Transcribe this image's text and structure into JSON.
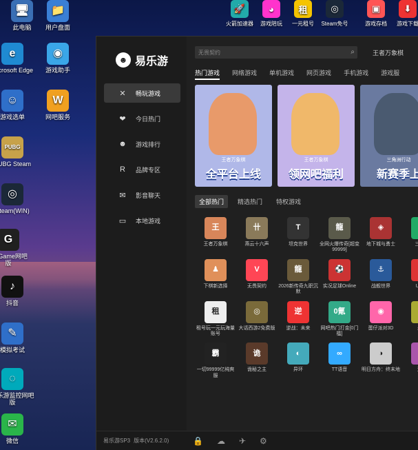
{
  "desktop": {
    "icons": [
      {
        "label": "此电脑",
        "glyph": "🖥",
        "color": "#3a6fb5"
      },
      {
        "label": "用户盘面",
        "glyph": "📁",
        "color": "#3a7fd5"
      },
      {
        "label": "Microsoft Edge",
        "glyph": "e",
        "color": "#1f8ad2"
      },
      {
        "label": "游戏助手",
        "glyph": "◉",
        "color": "#3aa6e8"
      },
      {
        "label": "游戏选单",
        "glyph": "☺",
        "color": "#2f6fc9"
      },
      {
        "label": "网吧服务",
        "glyph": "W",
        "color": "#f0a020"
      },
      {
        "label": "PUBG Steam",
        "glyph": "PUBG",
        "color": "#c7a24a"
      },
      {
        "label": "Steam(WIN)",
        "glyph": "◎",
        "color": "#1b2838"
      },
      {
        "label": "WeGame网吧版",
        "glyph": "G",
        "color": "#202020"
      },
      {
        "label": "抖音",
        "glyph": "♪",
        "color": "#111"
      },
      {
        "label": "模拟考试",
        "glyph": "✎",
        "color": "#2f6fc9"
      },
      {
        "label": "易乐游监控网吧版",
        "glyph": "◌",
        "color": "#0ab"
      },
      {
        "label": "微信",
        "glyph": "✉",
        "color": "#2ab54a"
      }
    ],
    "taskbar": [
      {
        "label": "火箭加速器",
        "glyph": "🚀",
        "color": "#2aa"
      },
      {
        "label": "游戏陪玩",
        "glyph": "◕",
        "color": "#f3c"
      },
      {
        "label": "一元租号",
        "glyph": "租",
        "color": "#f5c400"
      },
      {
        "label": "Steam免号",
        "glyph": "◎",
        "color": "#1b2838"
      },
      {
        "label": "游戏存档",
        "glyph": "▣",
        "color": "#f55"
      },
      {
        "label": "游戏下载",
        "glyph": "⬇",
        "color": "#e33"
      }
    ]
  },
  "app": {
    "logo_text": "易乐游",
    "nav": [
      {
        "label": "畅玩游戏",
        "icon": "✕",
        "active": true
      },
      {
        "label": "今日热门",
        "icon": "❤",
        "active": false
      },
      {
        "label": "游戏排行",
        "icon": "☻",
        "active": false
      },
      {
        "label": "品牌专区",
        "icon": "R",
        "active": false
      },
      {
        "label": "影音聊天",
        "icon": "✉",
        "active": false
      },
      {
        "label": "本地游戏",
        "icon": "▭",
        "active": false
      }
    ],
    "search_placeholder": "无畏契约",
    "user_label": "王者万象棋",
    "categories": [
      "热门游戏",
      "网络游戏",
      "单机游戏",
      "网页游戏",
      "手机游戏",
      "游戏服"
    ],
    "banners": [
      {
        "brand": "王者万象棋",
        "slogan": "全平台上线",
        "bg": "#b0b8e8",
        "art": "#e89a6a"
      },
      {
        "brand": "王者万象棋",
        "slogan": "领网吧福利",
        "bg": "#c4b4ea",
        "art": "#f0b86a"
      },
      {
        "brand": "三角洲行动",
        "slogan": "新赛季上",
        "bg": "#6a7aa0",
        "art": "#4a5a70"
      }
    ],
    "sub_tabs": [
      "全部热门",
      "精选热门",
      "特权游戏"
    ],
    "games": [
      {
        "name": "王者万象棋",
        "glyph": "王",
        "color": "#d8865a"
      },
      {
        "name": "燕云十六声",
        "glyph": "卄",
        "color": "#8a7a5a"
      },
      {
        "name": "坦克世界",
        "glyph": "T",
        "color": "#333"
      },
      {
        "name": "全网火爆传奇[超变99999]",
        "glyph": "龍",
        "color": "#5a5a4a"
      },
      {
        "name": "地下城与勇士",
        "glyph": "◈",
        "color": "#a33"
      },
      {
        "name": "三角洲",
        "glyph": "△",
        "color": "#2a6"
      },
      {
        "name": "下棋新选择",
        "glyph": "♟",
        "color": "#e0905a"
      },
      {
        "name": "无畏契约",
        "glyph": "V",
        "color": "#ff4655"
      },
      {
        "name": "2026新传奇九职沉默",
        "glyph": "龍",
        "color": "#6a5a3a"
      },
      {
        "name": "实况足球Online",
        "glyph": "⚽",
        "color": "#c33"
      },
      {
        "name": "战舰世界",
        "glyph": "⚓",
        "color": "#2a5a9a"
      },
      {
        "name": "U号租",
        "glyph": "U",
        "color": "#d33"
      },
      {
        "name": "租号玩一元玩海量账号",
        "glyph": "租",
        "color": "#eee"
      },
      {
        "name": "大话西游2免费版",
        "glyph": "◎",
        "color": "#7a6a3a"
      },
      {
        "name": "逆战：未来",
        "glyph": "逆",
        "color": "#e33"
      },
      {
        "name": "网吧热门打金[0门槛]",
        "glyph": "0氪",
        "color": "#3a8"
      },
      {
        "name": "蛋仔派对3D",
        "glyph": "◉",
        "color": "#f6a"
      },
      {
        "name": "永劫",
        "glyph": "永",
        "color": "#aa3"
      },
      {
        "name": "一切99999亿纯爽服",
        "glyph": "霸",
        "color": "#222"
      },
      {
        "name": "诡秘之主",
        "glyph": "诡",
        "color": "#5a3a2a"
      },
      {
        "name": "异环",
        "glyph": "◐",
        "color": "#4ab"
      },
      {
        "name": "TT语音",
        "glyph": "∞",
        "color": "#3af"
      },
      {
        "name": "明日方舟：终末地",
        "glyph": "◑",
        "color": "#ccc"
      },
      {
        "name": "遗忘",
        "glyph": "遗",
        "color": "#a5a"
      }
    ],
    "version": "版本(V2.6.2.0)",
    "status_label": "易乐游SP3",
    "tool_icons": [
      "🔒",
      "☁",
      "✈",
      "⚙"
    ]
  }
}
